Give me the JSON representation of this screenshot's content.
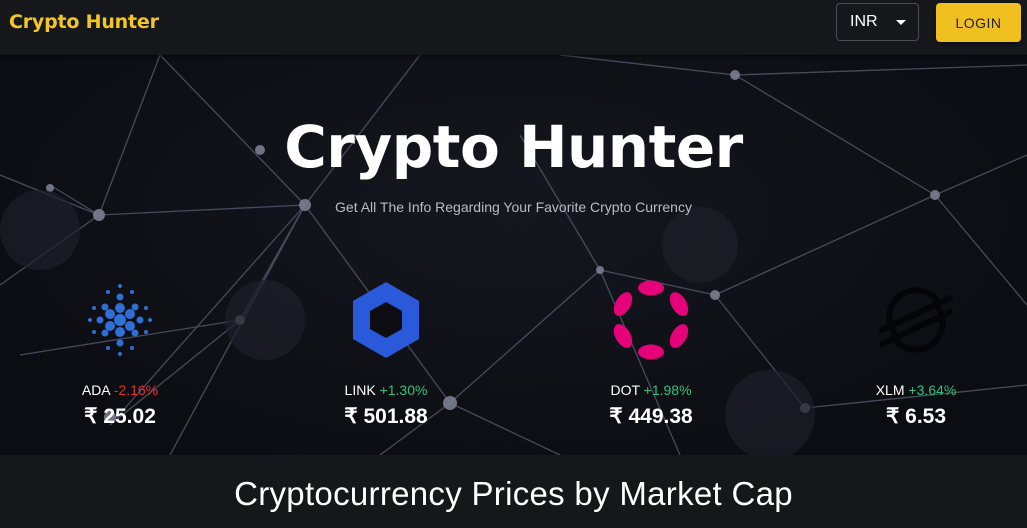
{
  "navbar": {
    "brand": "Crypto Hunter",
    "currency_selected": "INR",
    "login_label": "LOGIN"
  },
  "hero": {
    "title": "Crypto Hunter",
    "subtitle": "Get All The Info Regarding Your Favorite Crypto Currency"
  },
  "carousel": [
    {
      "symbol": "ADA",
      "change": "-2.16%",
      "price": "₹ 25.02",
      "icon": "cardano-icon"
    },
    {
      "symbol": "LINK",
      "change": "+1.30%",
      "price": "₹ 501.88",
      "icon": "chainlink-icon"
    },
    {
      "symbol": "DOT",
      "change": "+1.98%",
      "price": "₹ 449.38",
      "icon": "polkadot-icon"
    },
    {
      "symbol": "XLM",
      "change": "+3.64%",
      "price": "₹ 6.53",
      "icon": "stellar-icon"
    }
  ],
  "section": {
    "title": "Cryptocurrency Prices by Market Cap"
  },
  "colors": {
    "accent": "#f0c020",
    "positive": "#2fc27b",
    "negative": "#e0332f",
    "cardano": "#2f6fd6",
    "chainlink": "#2a5ada",
    "polkadot": "#e6007a"
  }
}
